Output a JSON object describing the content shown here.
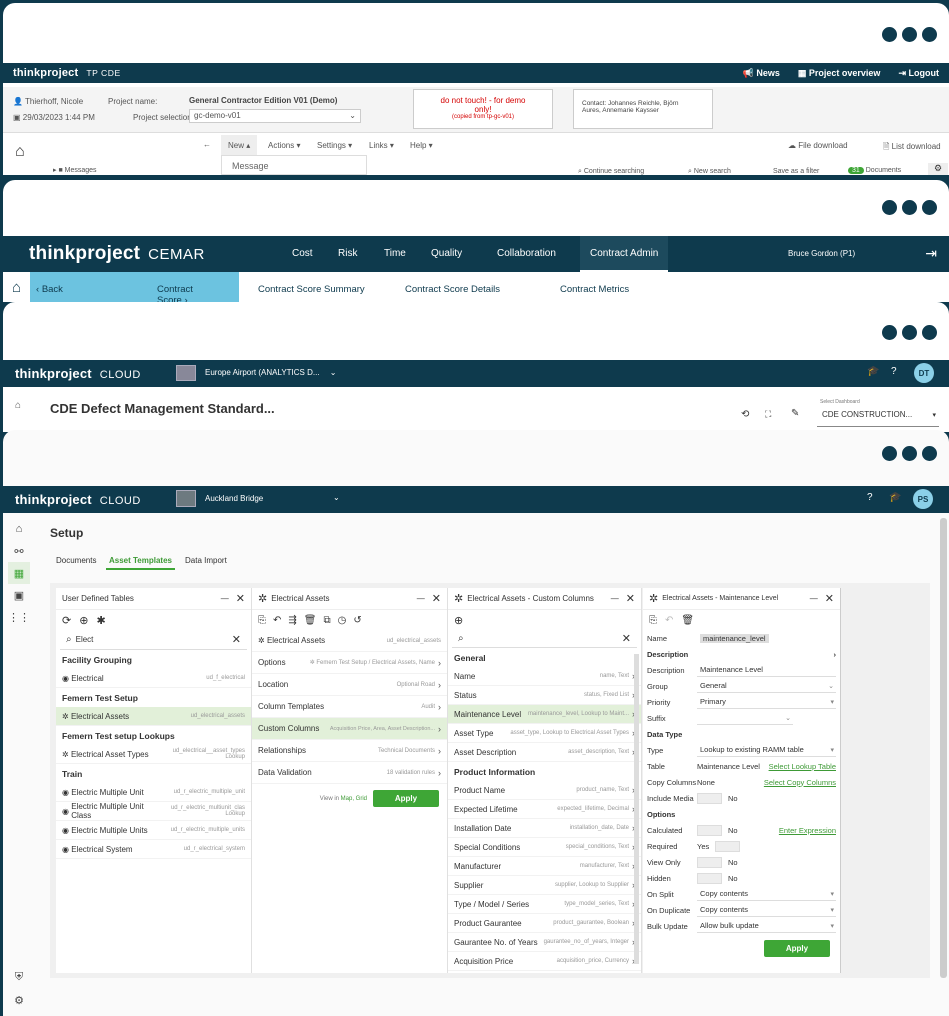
{
  "cde": {
    "brand": "thinkproject",
    "product": "TP CDE",
    "top_actions": [
      "News",
      "Project overview",
      "Logout"
    ],
    "user": "Thierhoff, Nicole",
    "datetime": "29/03/2023 1:44 PM",
    "project_name_label": "Project name:",
    "project_name": "General Contractor Edition V01 (Demo)",
    "project_selection_label": "Project selection:",
    "project_selection_value": "gc-demo-v01",
    "notice_line1": "do not touch! - for demo",
    "notice_line2": "only!",
    "notice_line3": "(copied from tp-gc-v01)",
    "contact_line1": "Contact: Johannes Reichle, Björn",
    "contact_line2": "Aures, Annemarie Kaysser",
    "menu": [
      "New ▴",
      "Actions ▾",
      "Settings ▾",
      "Links ▾",
      "Help ▾"
    ],
    "dropdown_item": "Message",
    "file_download": "File download",
    "list_download": "List download",
    "tree_item": "Messages",
    "continue_searching": "Continue searching",
    "new_search": "New search",
    "save_filter": "Save as a filter",
    "documents_count": "31",
    "documents_label": "Documents"
  },
  "cemar": {
    "brand": "thinkproject",
    "product": "CEMAR",
    "nav": [
      "Cost",
      "Risk",
      "Time",
      "Quality",
      "Collaboration",
      "Contract Admin"
    ],
    "user": "Bruce Gordon (P1)",
    "back": "Back",
    "tabs": [
      "Contract Score",
      "Contract Score Summary",
      "Contract Score Details",
      "Contract Metrics"
    ]
  },
  "cloud1": {
    "brand": "thinkproject",
    "product": "CLOUD",
    "project": "Europe Airport (ANALYTICS D...",
    "avatar": "DT",
    "title": "CDE Defect Management Standard...",
    "dashboard_label": "Select Dashboard",
    "dashboard_value": "CDE CONSTRUCTION..."
  },
  "cloud2": {
    "brand": "thinkproject",
    "product": "CLOUD",
    "project": "Auckland Bridge",
    "avatar": "PS",
    "setup_title": "Setup",
    "tabs": [
      "Documents",
      "Asset Templates",
      "Data Import"
    ],
    "p1": {
      "title": "User Defined Tables",
      "search": "Elect",
      "groups": [
        {
          "name": "Facility Grouping",
          "items": [
            {
              "label": "Electrical",
              "code": "ud_f_electrical"
            }
          ]
        },
        {
          "name": "Femern Test Setup",
          "items": [
            {
              "label": "Electrical Assets",
              "code": "ud_electrical_assets"
            }
          ]
        },
        {
          "name": "Femern Test setup Lookups",
          "items": [
            {
              "label": "Electrical Asset Types",
              "code": "ud_electrical__asset_types Lookup"
            }
          ]
        },
        {
          "name": "Train",
          "items": [
            {
              "label": "Electric Multiple Unit",
              "code": "ud_r_electric_multiple_unit"
            },
            {
              "label": "Electric Multiple Unit Class",
              "code": "ud_r_electric_multiunit_clas Lookup"
            },
            {
              "label": "Electric Multiple Units",
              "code": "ud_r_electric_multiple_units"
            },
            {
              "label": "Electrical System",
              "code": "ud_r_electrical_system"
            }
          ]
        }
      ]
    },
    "p2": {
      "title": "Electrical Assets",
      "entity": "Electrical Assets",
      "entity_code": "ud_electrical_assets",
      "rows": [
        {
          "label": "Options",
          "value": "Femern Test Setup / Electrical Assets, Name"
        },
        {
          "label": "Location",
          "value": "Optional Road"
        },
        {
          "label": "Column Templates",
          "value": "Audit"
        },
        {
          "label": "Custom Columns",
          "value": "Acquisition Price, Area, Asset Description..."
        },
        {
          "label": "Relationships",
          "value": "Technical Documents"
        },
        {
          "label": "Data Validation",
          "value": "18 validation rules"
        }
      ],
      "view_in": "View in",
      "view_links": "Map, Grid",
      "apply": "Apply"
    },
    "p3": {
      "title": "Electrical Assets - Custom Columns",
      "general": "General",
      "general_rows": [
        {
          "label": "Name",
          "value": "name, Text"
        },
        {
          "label": "Status",
          "value": "status, Fixed List"
        },
        {
          "label": "Maintenance Level",
          "value": "maintenance_level, Lookup to Maint..."
        },
        {
          "label": "Asset Type",
          "value": "asset_type, Lookup to Electrical Asset Types"
        },
        {
          "label": "Asset Description",
          "value": "asset_description, Text"
        }
      ],
      "product": "Product Information",
      "product_rows": [
        {
          "label": "Product Name",
          "value": "product_name, Text"
        },
        {
          "label": "Expected Lifetime",
          "value": "expected_lifetime, Decimal"
        },
        {
          "label": "Installation Date",
          "value": "installation_date, Date"
        },
        {
          "label": "Special Conditions",
          "value": "special_conditions, Text"
        },
        {
          "label": "Manufacturer",
          "value": "manufacturer, Text"
        },
        {
          "label": "Supplier",
          "value": "supplier, Lookup to Supplier"
        },
        {
          "label": "Type / Model / Series",
          "value": "type_model_series, Text"
        },
        {
          "label": "Product Gaurantee",
          "value": "product_gaurantee, Boolean"
        },
        {
          "label": "Gaurantee No. of Years",
          "value": "gaurantee_no_of_years, Integer"
        },
        {
          "label": "Acquisition Price",
          "value": "acquisition_price, Currency"
        }
      ]
    },
    "p4": {
      "title": "Electrical Assets - Maintenance Level",
      "name_label": "Name",
      "name_value": "maintenance_level",
      "description_head": "Description",
      "description_label": "Description",
      "description_value": "Maintenance Level",
      "group_label": "Group",
      "group_value": "General",
      "priority_label": "Priority",
      "priority_value": "Primary",
      "suffix_label": "Suffix",
      "datatype_head": "Data Type",
      "type_label": "Type",
      "type_value": "Lookup to existing RAMM table",
      "table_label": "Table",
      "table_value": "Maintenance Level",
      "select_lookup": "Select Lookup Table",
      "copy_label": "Copy Columns",
      "copy_value": "None",
      "select_copy": "Select Copy Columns",
      "include_media_label": "Include Media",
      "include_media_value": "No",
      "options_head": "Options",
      "calculated_label": "Calculated",
      "calculated_value": "No",
      "enter_expression": "Enter Expression",
      "required_label": "Required",
      "required_value": "Yes",
      "viewonly_label": "View Only",
      "viewonly_value": "No",
      "hidden_label": "Hidden",
      "hidden_value": "No",
      "onsplit_label": "On Split",
      "onsplit_value": "Copy contents",
      "ondup_label": "On Duplicate",
      "ondup_value": "Copy contents",
      "bulk_label": "Bulk Update",
      "bulk_value": "Allow bulk update",
      "apply": "Apply"
    }
  },
  "colors": {
    "navy": "#0e3a4d",
    "green": "#3ea636",
    "teal_tab": "#6cc3e0",
    "avatar": "#8bd0e8"
  }
}
